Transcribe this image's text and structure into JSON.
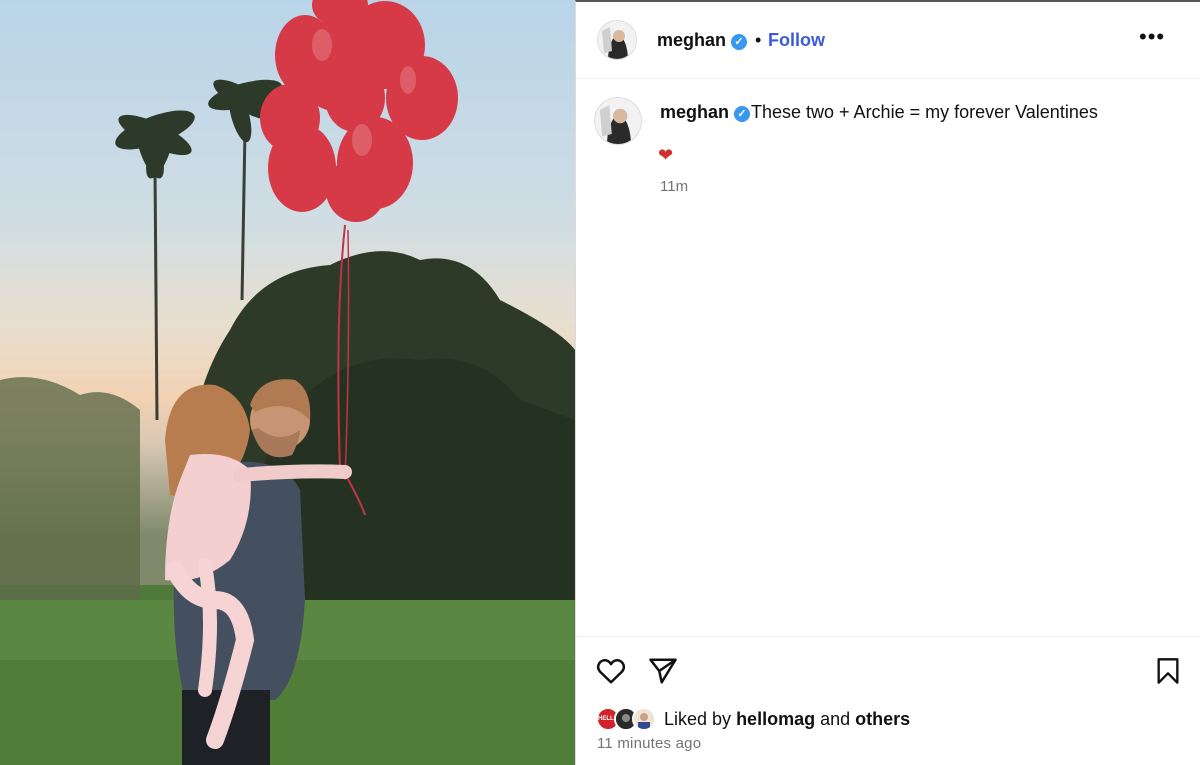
{
  "header": {
    "username": "meghan",
    "separator": "•",
    "follow_label": "Follow",
    "more_label": "•••"
  },
  "caption": {
    "username": "meghan",
    "text": "These two + Archie = my forever Valentines",
    "emoji": "❤",
    "time": "11m"
  },
  "engagement": {
    "liked_prefix": "Liked by",
    "liked_user": "hellomag",
    "liked_and": "and",
    "liked_others": "others",
    "timestamp": "11 minutes ago",
    "avatar_badge": "HELLO"
  },
  "icons": [
    "verified-badge-icon",
    "more-options-icon",
    "like-heart-icon",
    "share-icon",
    "save-bookmark-icon"
  ],
  "colors": {
    "follow": "#3b5bdb",
    "verified": "#3897f0",
    "balloon": "#d63a47",
    "muted_text": "#737373"
  }
}
